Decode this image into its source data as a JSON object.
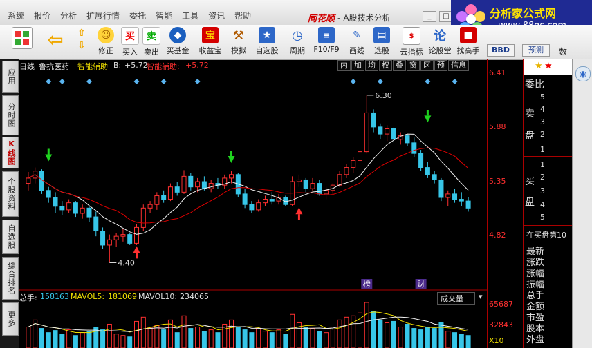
{
  "titlebar": {
    "menu": [
      "系统",
      "报价",
      "分析",
      "扩展行情",
      "委托",
      "智能",
      "工具",
      "资讯",
      "帮助"
    ],
    "brand": "同花顺",
    "separator": "-",
    "subtitle": "A股技术分析"
  },
  "logo": {
    "title": "分析家公式网",
    "url": "www.88gs.com"
  },
  "toolbar": {
    "buttons": [
      "修正",
      "买入",
      "卖出",
      "买基金",
      "收益宝",
      "模拟",
      "自选股",
      "周期",
      "F10/F9",
      "画线",
      "选股",
      "云指标",
      "论股堂",
      "找高手"
    ],
    "bbd_label": "BBD",
    "predict_label": "预测",
    "shu_label": "数"
  },
  "left_tabs": [
    "应用",
    "分时图",
    "K线图",
    "个股资料",
    "自选股",
    "综合排名",
    "更多"
  ],
  "chart": {
    "period": "日线",
    "stock_name": "鲁抗医药",
    "indicator": "智能辅助",
    "b_label": "B:",
    "b_value": "+5.72",
    "indicator2_label": "智能辅助:",
    "indicator2_value": "+5.72",
    "tool_tabs": [
      "内",
      "加",
      "均",
      "权",
      "叠",
      "窗",
      "区",
      "预",
      "信息"
    ],
    "high_marker": "6.30",
    "low_marker": "4.40",
    "event_labels": [
      "榜",
      "财"
    ],
    "price_ticks": [
      "6.41",
      "5.88",
      "5.35",
      "4.82"
    ]
  },
  "volume": {
    "total_label": "总手:",
    "total_value": "158163",
    "mavol5_label": "MAVOL5:",
    "mavol5_value": "181069",
    "mavol10_label": "MAVOL10:",
    "mavol10_value": "234065",
    "selector": "成交量",
    "ticks": [
      "65687",
      "32843"
    ],
    "unit": "X10"
  },
  "right_panel": {
    "header": "委比",
    "sell_label": [
      "卖",
      "盘"
    ],
    "sell_levels": [
      "5",
      "4",
      "3",
      "2",
      "1"
    ],
    "buy_label": [
      "买",
      "盘"
    ],
    "buy_levels": [
      "1",
      "2",
      "3",
      "4",
      "5"
    ],
    "queue_text": "在买盘第10",
    "list": [
      "最新",
      "涨跌",
      "涨幅",
      "振幅",
      "总手",
      "金额",
      "市盈",
      "股本",
      "外盘"
    ]
  },
  "colors": {
    "up": "#ff3030",
    "down": "#37c6e8",
    "ma_white": "#f2f2f2",
    "ma_red": "#e00000",
    "chart_bg": "#000000"
  },
  "chart_data": {
    "type": "candlestick",
    "ylim": [
      4.2,
      6.55
    ],
    "candles": [
      {
        "o": 5.3,
        "h": 5.43,
        "l": 5.22,
        "c": 5.36
      },
      {
        "o": 5.36,
        "h": 5.48,
        "l": 5.3,
        "c": 5.44
      },
      {
        "o": 5.44,
        "h": 5.46,
        "l": 5.18,
        "c": 5.22
      },
      {
        "o": 5.22,
        "h": 5.26,
        "l": 5.08,
        "c": 5.14
      },
      {
        "o": 5.14,
        "h": 5.2,
        "l": 4.96,
        "c": 5.04
      },
      {
        "o": 5.04,
        "h": 5.1,
        "l": 4.94,
        "c": 5.0
      },
      {
        "o": 5.0,
        "h": 5.12,
        "l": 4.96,
        "c": 5.08
      },
      {
        "o": 5.08,
        "h": 5.1,
        "l": 4.92,
        "c": 4.96
      },
      {
        "o": 4.96,
        "h": 5.06,
        "l": 4.9,
        "c": 5.02
      },
      {
        "o": 5.02,
        "h": 5.04,
        "l": 4.86,
        "c": 4.92
      },
      {
        "o": 4.92,
        "h": 4.98,
        "l": 4.7,
        "c": 4.76
      },
      {
        "o": 4.76,
        "h": 4.8,
        "l": 4.56,
        "c": 4.6
      },
      {
        "o": 4.6,
        "h": 4.72,
        "l": 4.4,
        "c": 4.66
      },
      {
        "o": 4.66,
        "h": 4.74,
        "l": 4.58,
        "c": 4.7
      },
      {
        "o": 4.7,
        "h": 4.78,
        "l": 4.64,
        "c": 4.72
      },
      {
        "o": 4.72,
        "h": 4.74,
        "l": 4.6,
        "c": 4.62
      },
      {
        "o": 4.62,
        "h": 4.84,
        "l": 4.6,
        "c": 4.8
      },
      {
        "o": 4.8,
        "h": 5.06,
        "l": 4.76,
        "c": 5.02
      },
      {
        "o": 5.02,
        "h": 5.1,
        "l": 4.96,
        "c": 5.06
      },
      {
        "o": 5.06,
        "h": 5.2,
        "l": 5.0,
        "c": 5.16
      },
      {
        "o": 5.16,
        "h": 5.22,
        "l": 5.08,
        "c": 5.12
      },
      {
        "o": 5.12,
        "h": 5.3,
        "l": 5.1,
        "c": 5.26
      },
      {
        "o": 5.26,
        "h": 5.32,
        "l": 5.16,
        "c": 5.2
      },
      {
        "o": 5.2,
        "h": 5.45,
        "l": 5.18,
        "c": 5.38
      },
      {
        "o": 5.38,
        "h": 5.42,
        "l": 5.22,
        "c": 5.26
      },
      {
        "o": 5.26,
        "h": 5.36,
        "l": 5.2,
        "c": 5.32
      },
      {
        "o": 5.32,
        "h": 5.38,
        "l": 5.22,
        "c": 5.24
      },
      {
        "o": 5.24,
        "h": 5.34,
        "l": 5.2,
        "c": 5.3
      },
      {
        "o": 5.3,
        "h": 5.36,
        "l": 5.24,
        "c": 5.28
      },
      {
        "o": 5.28,
        "h": 5.4,
        "l": 5.24,
        "c": 5.36
      },
      {
        "o": 5.36,
        "h": 5.44,
        "l": 5.3,
        "c": 5.4
      },
      {
        "o": 5.4,
        "h": 5.42,
        "l": 5.14,
        "c": 5.18
      },
      {
        "o": 5.18,
        "h": 5.24,
        "l": 5.02,
        "c": 5.06
      },
      {
        "o": 5.06,
        "h": 5.1,
        "l": 4.96,
        "c": 5.0
      },
      {
        "o": 5.0,
        "h": 5.12,
        "l": 4.98,
        "c": 5.08
      },
      {
        "o": 5.08,
        "h": 5.16,
        "l": 5.04,
        "c": 5.12
      },
      {
        "o": 5.12,
        "h": 5.2,
        "l": 5.06,
        "c": 5.1
      },
      {
        "o": 5.1,
        "h": 5.18,
        "l": 5.06,
        "c": 5.14
      },
      {
        "o": 5.14,
        "h": 5.16,
        "l": 5.04,
        "c": 5.06
      },
      {
        "o": 5.06,
        "h": 5.38,
        "l": 5.04,
        "c": 5.32
      },
      {
        "o": 5.32,
        "h": 5.4,
        "l": 5.26,
        "c": 5.34
      },
      {
        "o": 5.34,
        "h": 5.36,
        "l": 5.2,
        "c": 5.24
      },
      {
        "o": 5.24,
        "h": 5.36,
        "l": 5.22,
        "c": 5.3
      },
      {
        "o": 5.3,
        "h": 5.34,
        "l": 5.16,
        "c": 5.18
      },
      {
        "o": 5.18,
        "h": 5.26,
        "l": 5.12,
        "c": 5.22
      },
      {
        "o": 5.22,
        "h": 5.3,
        "l": 5.18,
        "c": 5.28
      },
      {
        "o": 5.28,
        "h": 5.44,
        "l": 5.26,
        "c": 5.4
      },
      {
        "o": 5.4,
        "h": 5.52,
        "l": 5.36,
        "c": 5.48
      },
      {
        "o": 5.48,
        "h": 5.6,
        "l": 5.42,
        "c": 5.56
      },
      {
        "o": 5.56,
        "h": 5.7,
        "l": 5.5,
        "c": 5.66
      },
      {
        "o": 5.66,
        "h": 6.3,
        "l": 5.64,
        "c": 6.1
      },
      {
        "o": 6.1,
        "h": 6.14,
        "l": 5.88,
        "c": 5.94
      },
      {
        "o": 5.94,
        "h": 5.98,
        "l": 5.8,
        "c": 5.86
      },
      {
        "o": 5.86,
        "h": 5.96,
        "l": 5.78,
        "c": 5.92
      },
      {
        "o": 5.92,
        "h": 5.94,
        "l": 5.76,
        "c": 5.8
      },
      {
        "o": 5.8,
        "h": 5.88,
        "l": 5.74,
        "c": 5.84
      },
      {
        "o": 5.84,
        "h": 5.86,
        "l": 5.72,
        "c": 5.76
      },
      {
        "o": 5.76,
        "h": 5.82,
        "l": 5.6,
        "c": 5.64
      },
      {
        "o": 5.64,
        "h": 5.68,
        "l": 5.44,
        "c": 5.48
      },
      {
        "o": 5.48,
        "h": 5.54,
        "l": 5.36,
        "c": 5.4
      },
      {
        "o": 5.4,
        "h": 5.44,
        "l": 5.3,
        "c": 5.34
      },
      {
        "o": 5.34,
        "h": 5.36,
        "l": 5.1,
        "c": 5.14
      },
      {
        "o": 5.14,
        "h": 5.22,
        "l": 5.04,
        "c": 5.18
      },
      {
        "o": 5.18,
        "h": 5.24,
        "l": 5.08,
        "c": 5.12
      },
      {
        "o": 5.12,
        "h": 5.2,
        "l": 5.04,
        "c": 5.1
      },
      {
        "o": 5.1,
        "h": 5.14,
        "l": 4.98,
        "c": 5.02
      }
    ],
    "volumes": [
      30,
      40,
      28,
      22,
      25,
      20,
      26,
      18,
      22,
      24,
      30,
      26,
      34,
      20,
      18,
      16,
      38,
      44,
      30,
      32,
      26,
      40,
      22,
      46,
      28,
      30,
      24,
      26,
      22,
      34,
      40,
      30,
      26,
      22,
      28,
      24,
      22,
      26,
      20,
      48,
      36,
      30,
      28,
      24,
      22,
      30,
      40,
      44,
      46,
      50,
      65,
      52,
      40,
      36,
      38,
      30,
      34,
      28,
      26,
      30,
      28,
      36,
      24,
      22,
      20,
      18
    ]
  }
}
